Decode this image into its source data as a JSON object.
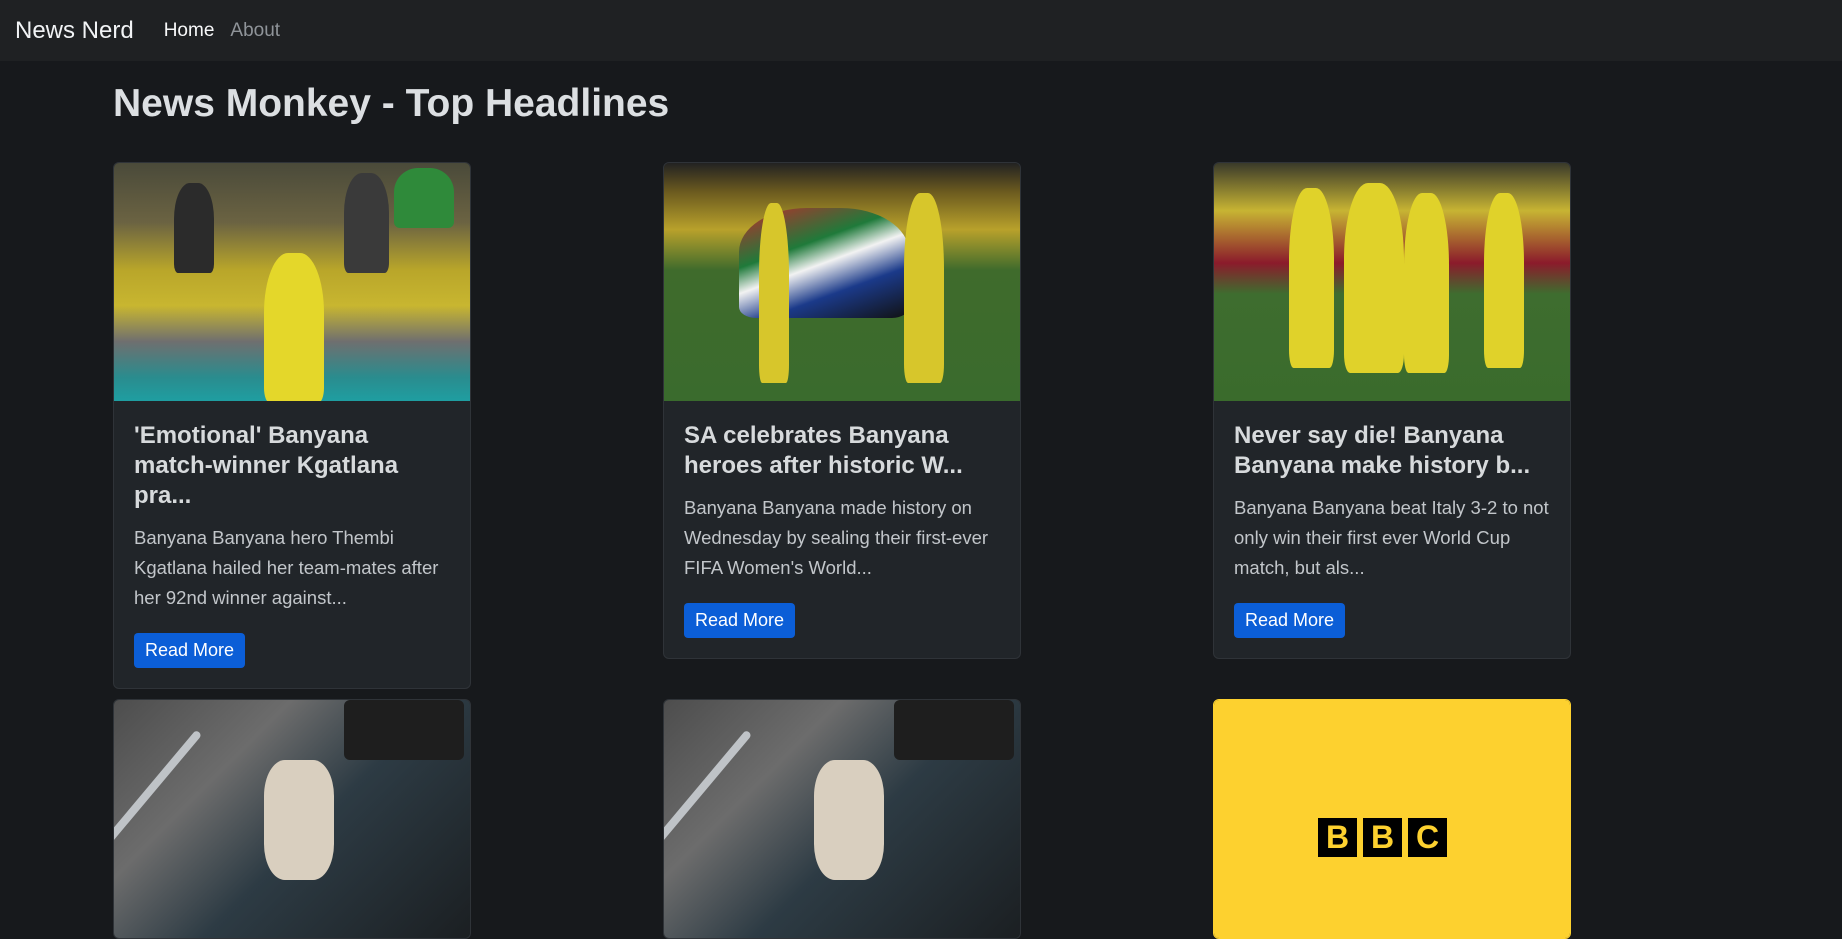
{
  "navbar": {
    "brand": "News Nerd",
    "links": [
      "Home",
      "About"
    ]
  },
  "page": {
    "title": "News Monkey - Top Headlines"
  },
  "articles": [
    {
      "title": "'Emotional' Banyana match-winner Kgatlana pra...",
      "description": "Banyana Banyana hero Thembi Kgatlana hailed her team-mates after her 92nd winner against...",
      "button": "Read More",
      "image": "player-celebrating-stadium"
    },
    {
      "title": "SA celebrates Banyana heroes after historic W...",
      "description": "Banyana Banyana made history on Wednesday by sealing their first-ever FIFA Women's World...",
      "button": "Read More",
      "image": "team-with-flag-pitch"
    },
    {
      "title": "Never say die! Banyana Banyana make history b...",
      "description": "Banyana Banyana beat Italy 3-2 to not only win their first ever World Cup match, but als...",
      "button": "Read More",
      "image": "team-celebrating-pitch"
    },
    {
      "image": "person-with-crutches"
    },
    {
      "image": "person-with-crutches"
    },
    {
      "image": "bbc-logo",
      "logo_text": [
        "B",
        "B",
        "C"
      ]
    }
  ],
  "colors": {
    "background": "#17191c",
    "navbar": "#1f2123",
    "card": "#212529",
    "button": "#0b5ed7",
    "bbc_yellow": "#fdd12f"
  }
}
